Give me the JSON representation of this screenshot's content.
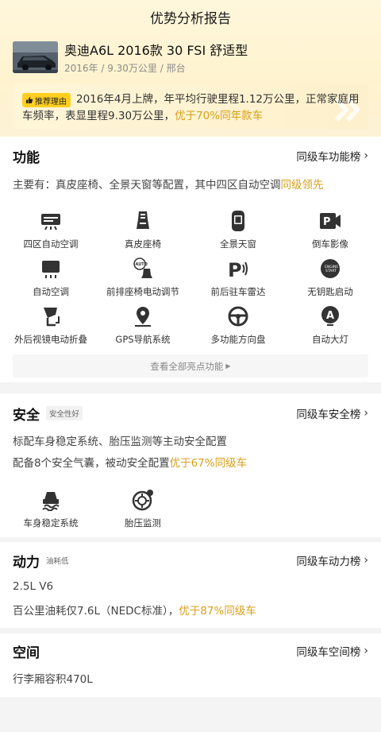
{
  "header": {
    "title": "优势分析报告",
    "car_name": "奥迪A6L 2016款 30 FSI 舒适型",
    "car_sub": "2016年 / 9.30万公里 / 邢台",
    "reason_badge": "推荐理由",
    "reason_text": "2016年4月上牌，年平均行驶里程1.12万公里，正常家庭用车频率，表显里程9.30万公里，",
    "reason_highlight": "优于70%同年款车"
  },
  "function": {
    "title": "功能",
    "rank_link": "同级车功能榜",
    "summary": "主要有：真皮座椅、全景天窗等配置，其中四区自动空调",
    "summary_highlight": "同级领先",
    "features": [
      {
        "label": "四区自动空调",
        "icon": "ac-icon"
      },
      {
        "label": "真皮座椅",
        "icon": "seat-icon"
      },
      {
        "label": "全景天窗",
        "icon": "sunroof-icon"
      },
      {
        "label": "倒车影像",
        "icon": "camera-icon"
      },
      {
        "label": "自动空调",
        "icon": "auto-ac-icon"
      },
      {
        "label": "前排座椅电动调节",
        "icon": "seat-adjust-icon"
      },
      {
        "label": "前后驻车雷达",
        "icon": "radar-icon"
      },
      {
        "label": "无钥匙启动",
        "icon": "keyless-icon"
      },
      {
        "label": "外后视镜电动折叠",
        "icon": "mirror-icon"
      },
      {
        "label": "GPS导航系统",
        "icon": "gps-icon"
      },
      {
        "label": "多功能方向盘",
        "icon": "steering-icon"
      },
      {
        "label": "自动大灯",
        "icon": "headlight-icon"
      }
    ],
    "more_label": "查看全部亮点功能"
  },
  "safety": {
    "title": "安全",
    "tag": "安全性好",
    "rank_link": "同级车安全榜",
    "line1": "标配车身稳定系统、胎压监测等主动安全配置",
    "line2": "配备8个安全气囊，被动安全配置",
    "line2_highlight": "优于67%同级车",
    "features": [
      {
        "label": "车身稳定系统",
        "icon": "esp-icon"
      },
      {
        "label": "胎压监测",
        "icon": "tire-icon"
      }
    ]
  },
  "power": {
    "title": "动力",
    "tag": "油耗低",
    "rank_link": "同级车动力榜",
    "line1": "2.5L V6",
    "line2": "百公里油耗仅7.6L（NEDC标准），",
    "line2_highlight": "优于87%同级车"
  },
  "space": {
    "title": "空间",
    "rank_link": "同级车空间榜",
    "line1": "行李厢容积470L"
  },
  "colors": {
    "accent": "#d7a01a",
    "badge": "#ffcf20",
    "header_bg": "#fff5d6"
  }
}
